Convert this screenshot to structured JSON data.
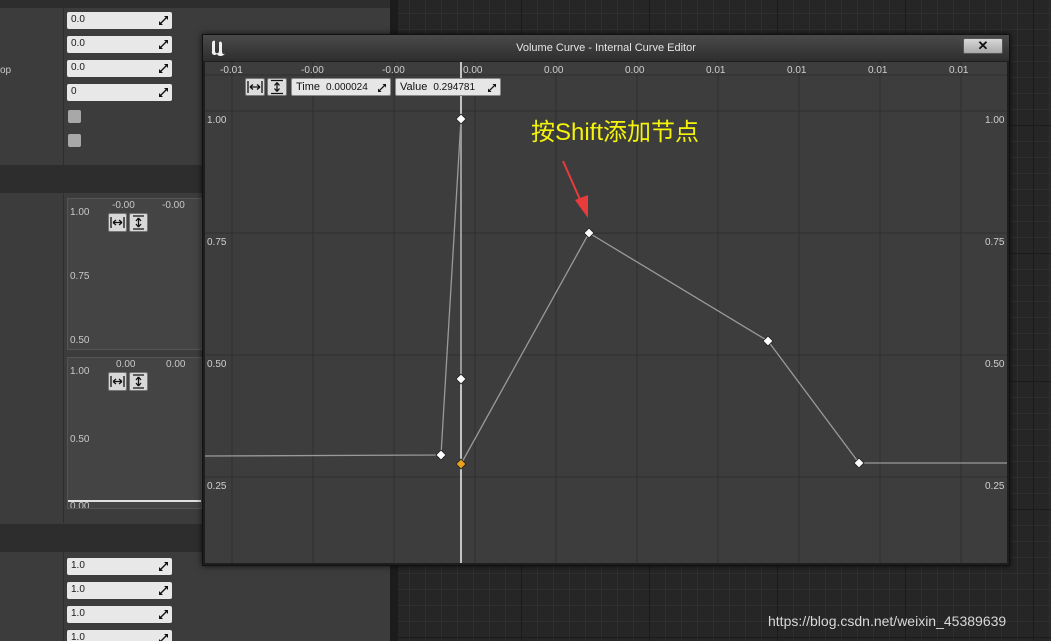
{
  "details": {
    "rows_top": [
      "0.0",
      "0.0",
      "0.0",
      "0"
    ],
    "partial_label": "op",
    "graph1": {
      "ticks": [
        "-0.00",
        "-0.00"
      ],
      "y_labels": [
        "1.00",
        "0.75",
        "0.50"
      ]
    },
    "graph2": {
      "ticks": [
        "0.00",
        "0.00"
      ],
      "y_labels": [
        "1.00",
        "0.50",
        "0.00"
      ]
    },
    "rows_bottom": [
      "1.0",
      "1.0",
      "1.0",
      "1.0"
    ]
  },
  "curve_editor": {
    "title": "Volume Curve - Internal Curve Editor",
    "close_label": "✕",
    "toolbar": {
      "time_label": "Time",
      "time_value": "0.000024",
      "value_label": "Value",
      "value_value": "0.294781"
    },
    "x_tick_labels": [
      "-0.01",
      "-0.00",
      "-0.00",
      "0.00",
      "0.00",
      "0.00",
      "0.01",
      "0.01",
      "0.01",
      "0.01"
    ],
    "y_tick_labels_left": [
      "1.00",
      "0.75",
      "0.50",
      "0.25"
    ],
    "y_tick_labels_right": [
      "1.00",
      "0.75",
      "0.50",
      "0.25"
    ],
    "colors": {
      "curve": "#9a9a9a",
      "key": "#ffffff",
      "selected_key": "#e8a020",
      "cursor_line": "#f2f2f2",
      "annotation": "#f4f40b",
      "arrow": "#e83b3b"
    }
  },
  "annotation": "按Shift添加节点",
  "watermark": "https://blog.csdn.net/weixin_45389639"
}
